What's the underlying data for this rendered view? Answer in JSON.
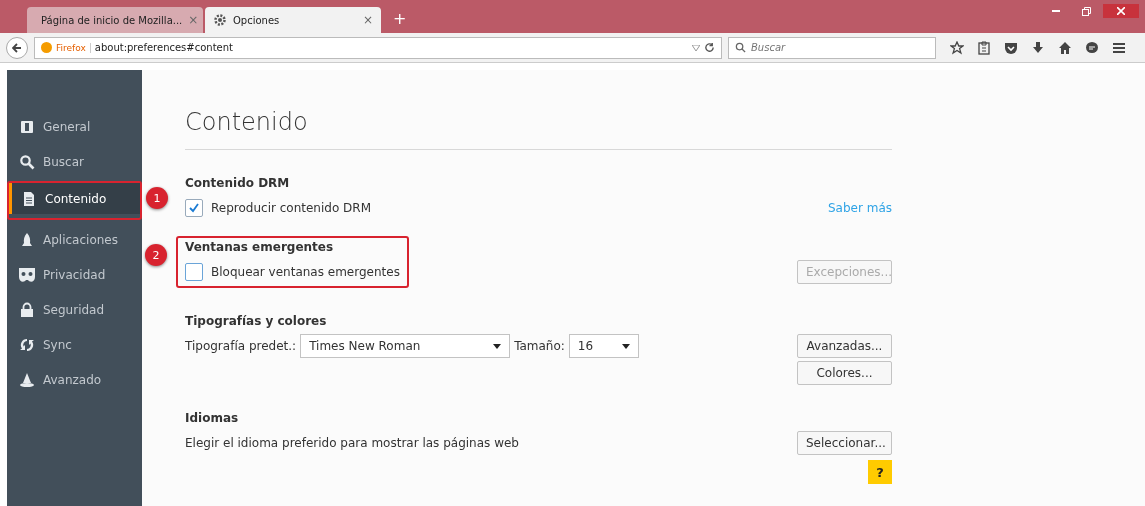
{
  "tabs": [
    {
      "title": "Página de inicio de Mozilla...",
      "close": "×",
      "selected": false
    },
    {
      "title": "Opciones",
      "close": "×",
      "selected": true
    }
  ],
  "new_tab": "+",
  "address_bar": {
    "identity": "Firefox",
    "url": "about:preferences#content"
  },
  "search": {
    "placeholder": "Buscar"
  },
  "sidebar": {
    "items": [
      {
        "label": "General",
        "selected": false
      },
      {
        "label": "Buscar",
        "selected": false
      },
      {
        "label": "Contenido",
        "selected": true,
        "annotation": "1"
      },
      {
        "label": "Aplicaciones",
        "selected": false
      },
      {
        "label": "Privacidad",
        "selected": false
      },
      {
        "label": "Seguridad",
        "selected": false
      },
      {
        "label": "Sync",
        "selected": false
      },
      {
        "label": "Avanzado",
        "selected": false
      }
    ]
  },
  "page_title": "Contenido",
  "sections": [
    {
      "heading": "Contenido DRM",
      "rows": [
        {
          "kind": "checkbox",
          "label": "Reproducir contenido DRM",
          "checked": true,
          "link": "Saber más"
        }
      ]
    },
    {
      "heading": "Ventanas emergentes",
      "annotation": "2",
      "rows": [
        {
          "kind": "checkbox",
          "label": "Bloquear ventanas emergentes",
          "checked": false,
          "button": "Excepciones...",
          "button_disabled": true
        }
      ]
    },
    {
      "heading": "Tipografías y colores",
      "rows": [
        {
          "kind": "fonts",
          "font_label": "Tipografía predet.:",
          "font_value": "Times New Roman",
          "size_label": "Tamaño:",
          "size_value": "16",
          "button": "Avanzadas..."
        },
        {
          "kind": "button",
          "button": "Colores..."
        }
      ]
    },
    {
      "heading": "Idiomas",
      "rows": [
        {
          "kind": "text",
          "text": "Elegir el idioma preferido para mostrar las páginas web",
          "button": "Seleccionar..."
        }
      ]
    }
  ],
  "help": "?"
}
